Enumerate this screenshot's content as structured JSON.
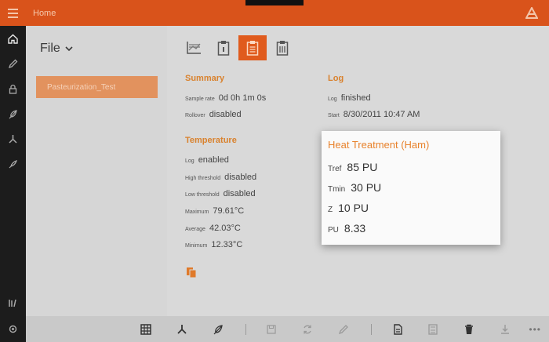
{
  "app": {
    "title": "Home"
  },
  "left": {
    "file_label": "File",
    "items": [
      {
        "label": "Pasteurization_Test"
      }
    ]
  },
  "summary": {
    "heading": "Summary",
    "rows": [
      {
        "label": "Sample rate",
        "value": "0d 0h 1m 0s"
      },
      {
        "label": "Rollover",
        "value": "disabled"
      }
    ]
  },
  "log": {
    "heading": "Log",
    "rows": [
      {
        "label": "Log",
        "value": "finished"
      },
      {
        "label": "Start",
        "value": "8/30/2011 10:47 AM"
      }
    ]
  },
  "temperature": {
    "heading": "Temperature",
    "rows": [
      {
        "label": "Log",
        "value": "enabled"
      },
      {
        "label": "High threshold",
        "value": "disabled"
      },
      {
        "label": "Low threshold",
        "value": "disabled"
      },
      {
        "label": "Maximum",
        "value": "79.61°C"
      },
      {
        "label": "Average",
        "value": "42.03°C"
      },
      {
        "label": "Minimum",
        "value": "12.33°C"
      }
    ]
  },
  "popup": {
    "title": "Heat Treatment (Ham)",
    "rows": [
      {
        "label": "Tref",
        "value": "85 PU"
      },
      {
        "label": "Tmin",
        "value": "30 PU"
      },
      {
        "label": "Z",
        "value": "10 PU"
      },
      {
        "label": "PU",
        "value": "8.33"
      }
    ]
  },
  "colors": {
    "accent": "#d9531b",
    "active_tool": "#e05b1d",
    "section_heading": "#d9822e"
  }
}
